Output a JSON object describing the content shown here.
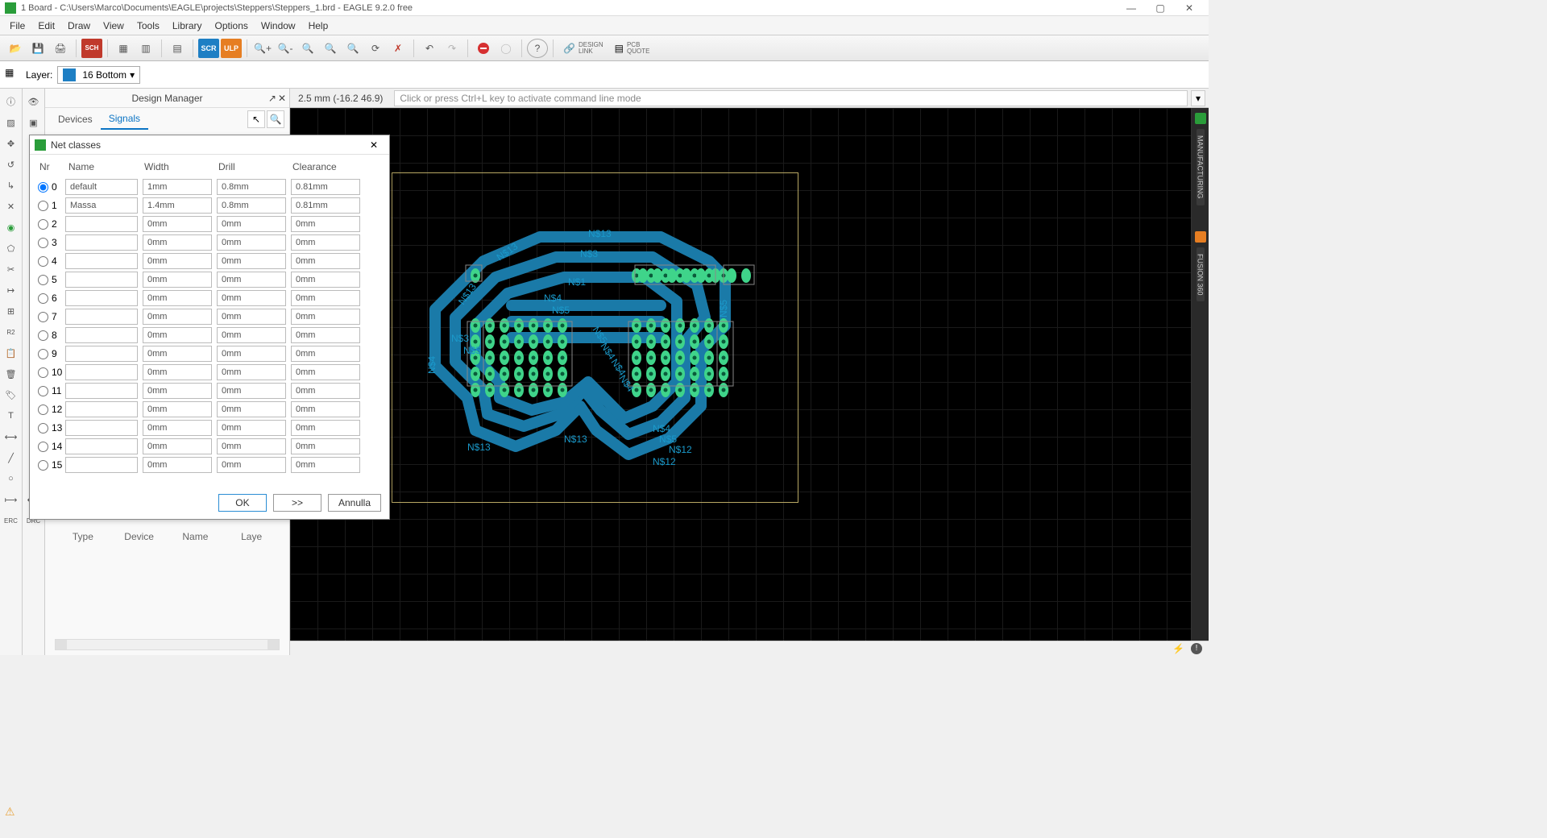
{
  "window": {
    "title": "1 Board - C:\\Users\\Marco\\Documents\\EAGLE\\projects\\Steppers\\Steppers_1.brd - EAGLE 9.2.0 free"
  },
  "menu": [
    "File",
    "Edit",
    "Draw",
    "View",
    "Tools",
    "Library",
    "Options",
    "Window",
    "Help"
  ],
  "toolbar": {
    "link1_top": "DESIGN",
    "link1_bot": "LINK",
    "link2_top": "PCB",
    "link2_bot": "QUOTE"
  },
  "layerbar": {
    "label": "Layer:",
    "selected": "16 Bottom"
  },
  "sidepanel": {
    "title": "Design Manager",
    "tabs": [
      "Devices",
      "Signals"
    ],
    "list_headers": [
      "Type",
      "Device",
      "Name",
      "Laye"
    ]
  },
  "status": {
    "coords": "2.5 mm (-16.2 46.9)",
    "cmd_placeholder": "Click or press Ctrl+L key to activate command line mode"
  },
  "rightrail": [
    "MANUFACTURING",
    "FUSION 360"
  ],
  "net_labels": [
    "N$13",
    "N$13",
    "N$3",
    "N$13",
    "N$1",
    "N$4",
    "N$5",
    "N$3",
    "N$5",
    "N$5",
    "N$4",
    "N$4",
    "N$4",
    "N$5",
    "N$4",
    "N$13",
    "N$13",
    "N$4",
    "N$5",
    "N$12",
    "N$12"
  ],
  "dialog": {
    "title": "Net classes",
    "headers": [
      "Nr",
      "Name",
      "Width",
      "Drill",
      "Clearance"
    ],
    "rows": [
      {
        "nr": "0",
        "name": "default",
        "width": "1mm",
        "drill": "0.8mm",
        "clearance": "0.81mm",
        "sel": true
      },
      {
        "nr": "1",
        "name": "Massa",
        "width": "1.4mm",
        "drill": "0.8mm",
        "clearance": "0.81mm",
        "sel": false
      },
      {
        "nr": "2",
        "name": "",
        "width": "0mm",
        "drill": "0mm",
        "clearance": "0mm",
        "sel": false
      },
      {
        "nr": "3",
        "name": "",
        "width": "0mm",
        "drill": "0mm",
        "clearance": "0mm",
        "sel": false
      },
      {
        "nr": "4",
        "name": "",
        "width": "0mm",
        "drill": "0mm",
        "clearance": "0mm",
        "sel": false
      },
      {
        "nr": "5",
        "name": "",
        "width": "0mm",
        "drill": "0mm",
        "clearance": "0mm",
        "sel": false
      },
      {
        "nr": "6",
        "name": "",
        "width": "0mm",
        "drill": "0mm",
        "clearance": "0mm",
        "sel": false
      },
      {
        "nr": "7",
        "name": "",
        "width": "0mm",
        "drill": "0mm",
        "clearance": "0mm",
        "sel": false
      },
      {
        "nr": "8",
        "name": "",
        "width": "0mm",
        "drill": "0mm",
        "clearance": "0mm",
        "sel": false
      },
      {
        "nr": "9",
        "name": "",
        "width": "0mm",
        "drill": "0mm",
        "clearance": "0mm",
        "sel": false
      },
      {
        "nr": "10",
        "name": "",
        "width": "0mm",
        "drill": "0mm",
        "clearance": "0mm",
        "sel": false
      },
      {
        "nr": "11",
        "name": "",
        "width": "0mm",
        "drill": "0mm",
        "clearance": "0mm",
        "sel": false
      },
      {
        "nr": "12",
        "name": "",
        "width": "0mm",
        "drill": "0mm",
        "clearance": "0mm",
        "sel": false
      },
      {
        "nr": "13",
        "name": "",
        "width": "0mm",
        "drill": "0mm",
        "clearance": "0mm",
        "sel": false
      },
      {
        "nr": "14",
        "name": "",
        "width": "0mm",
        "drill": "0mm",
        "clearance": "0mm",
        "sel": false
      },
      {
        "nr": "15",
        "name": "",
        "width": "0mm",
        "drill": "0mm",
        "clearance": "0mm",
        "sel": false
      }
    ],
    "buttons": {
      "ok": "OK",
      "more": ">>",
      "cancel": "Annulla"
    }
  }
}
